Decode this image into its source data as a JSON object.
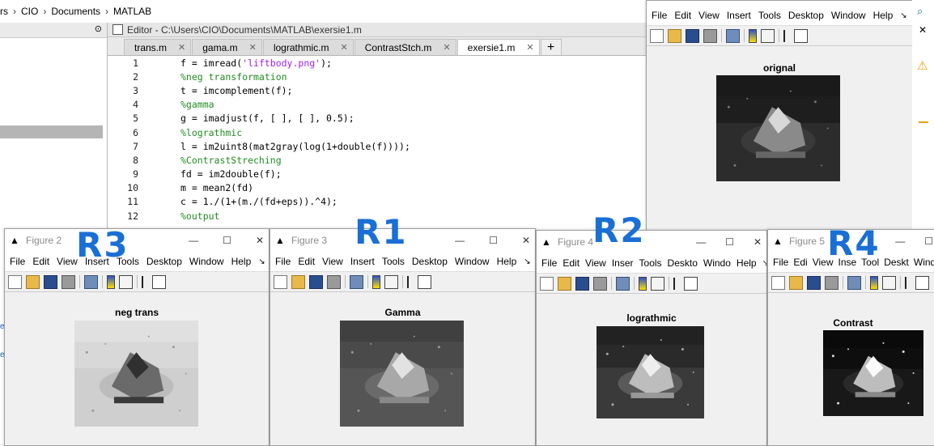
{
  "breadcrumb": [
    "rs",
    "CIO",
    "Documents",
    "MATLAB"
  ],
  "editor": {
    "title": "Editor - C:\\Users\\CIO\\Documents\\MATLAB\\exersie1.m",
    "tabs": [
      "trans.m",
      "gama.m",
      "lograthmic.m",
      "ContrastStch.m",
      "exersie1.m"
    ],
    "active_tab": "exersie1.m",
    "lines": [
      {
        "n": "1",
        "pre": "f = imread(",
        "str": "'liftbody.png'",
        "post": ");",
        "cm": ""
      },
      {
        "n": "2",
        "pre": "",
        "str": "",
        "post": "",
        "cm": "%neg transformation"
      },
      {
        "n": "3",
        "pre": "t = imcomplement(f);",
        "str": "",
        "post": "",
        "cm": ""
      },
      {
        "n": "4",
        "pre": "",
        "str": "",
        "post": "",
        "cm": "%gamma"
      },
      {
        "n": "5",
        "pre": "g = imadjust(f, [ ], [ ], 0.5);",
        "str": "",
        "post": "",
        "cm": ""
      },
      {
        "n": "6",
        "pre": "",
        "str": "",
        "post": "",
        "cm": "%lograthmic"
      },
      {
        "n": "7",
        "pre": "l = im2uint8(mat2gray(log(1+double(f))));",
        "str": "",
        "post": "",
        "cm": ""
      },
      {
        "n": "8",
        "pre": "",
        "str": "",
        "post": "",
        "cm": "%ContrastStreching"
      },
      {
        "n": "9",
        "pre": "fd = im2double(f);",
        "str": "",
        "post": "",
        "cm": ""
      },
      {
        "n": "10",
        "pre": "m = mean2(fd)",
        "str": "",
        "post": "",
        "cm": ""
      },
      {
        "n": "11",
        "pre": "c = 1./(1+(m./(fd+eps)).^4);",
        "str": "",
        "post": "",
        "cm": ""
      },
      {
        "n": "12",
        "pre": "",
        "str": "",
        "post": "",
        "cm": "%output"
      }
    ]
  },
  "figures": {
    "main": {
      "menu": [
        "File",
        "Edit",
        "View",
        "Insert",
        "Tools",
        "Desktop",
        "Window",
        "Help"
      ],
      "plot_title": "orignal"
    },
    "fig2": {
      "title": "Figure 2",
      "menu": [
        "File",
        "Edit",
        "View",
        "Insert",
        "Tools",
        "Desktop",
        "Window",
        "Help"
      ],
      "plot_title": "neg trans",
      "label": "R3"
    },
    "fig3": {
      "title": "Figure 3",
      "menu": [
        "File",
        "Edit",
        "View",
        "Insert",
        "Tools",
        "Desktop",
        "Window",
        "Help"
      ],
      "plot_title": "Gamma",
      "label": "R1"
    },
    "fig4": {
      "title": "Figure 4",
      "menu": [
        "File",
        "Edit",
        "View",
        "Inser",
        "Tools",
        "Deskto",
        "Windo",
        "Help"
      ],
      "plot_title": "lograthmic",
      "label": "R2"
    },
    "fig5": {
      "title": "Figure 5",
      "menu": [
        "File",
        "Edi",
        "View",
        "Inse",
        "Tool",
        "Deskt",
        "Wind"
      ],
      "plot_title": "Contrast",
      "label": "R4"
    }
  },
  "icon_names": [
    "new-file-icon",
    "open-icon",
    "save-icon",
    "print-icon",
    "link-icon",
    "colorbar-icon",
    "legend-icon",
    "pointer-icon",
    "dock-icon"
  ]
}
